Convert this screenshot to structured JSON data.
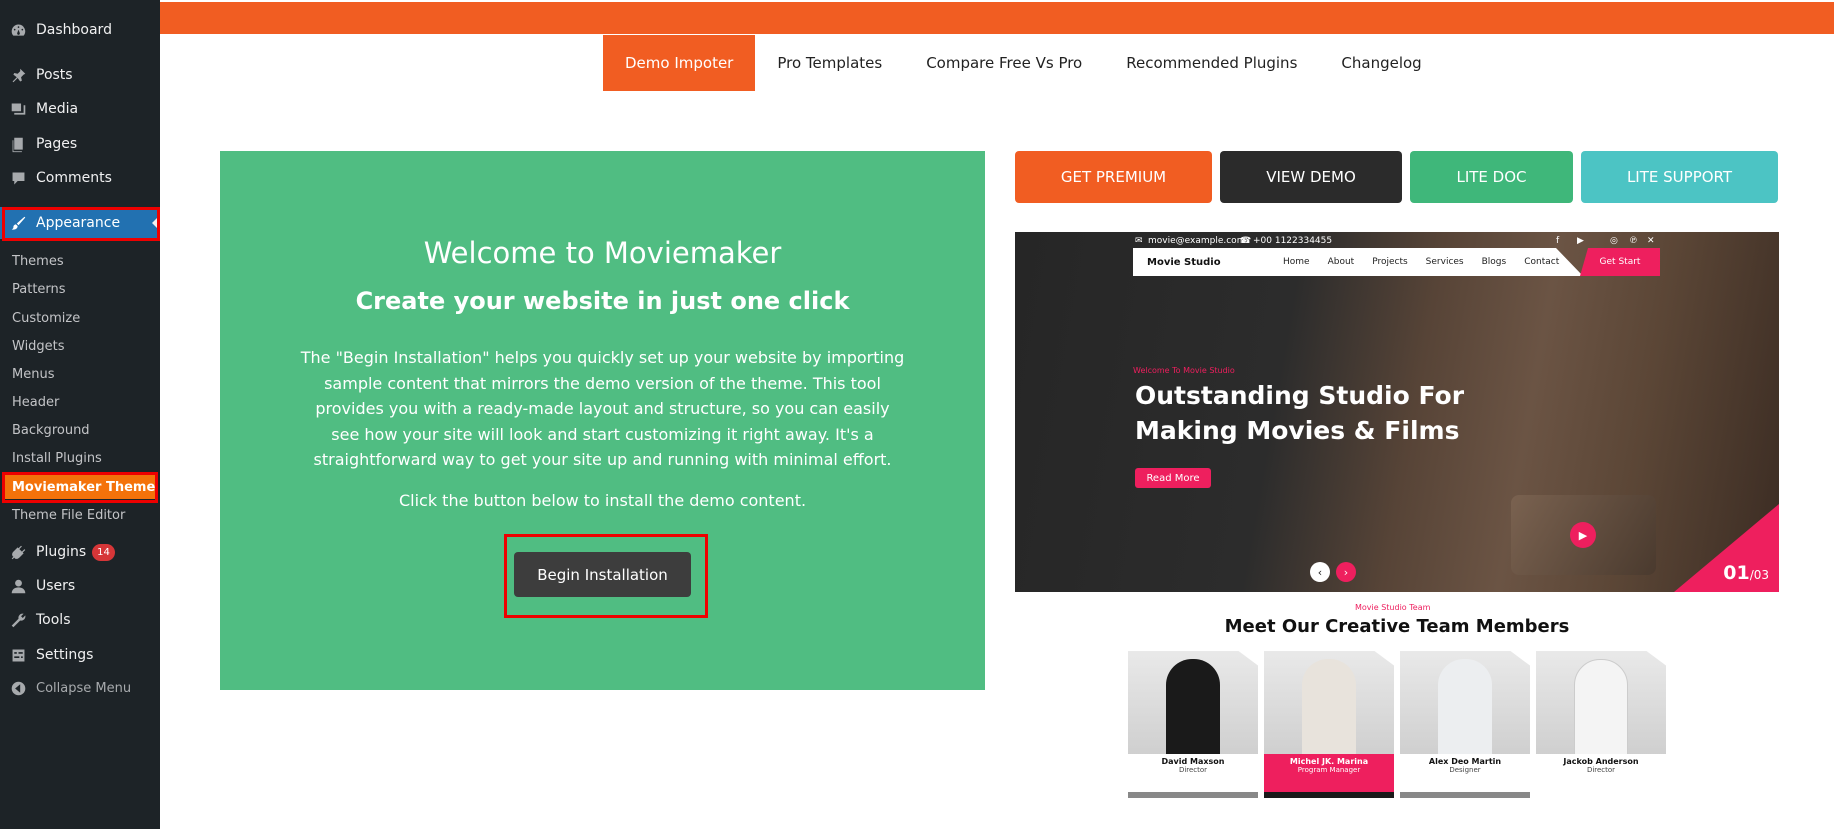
{
  "sidebar": {
    "items": [
      {
        "label": "Dashboard",
        "icon": "dashboard-icon"
      },
      {
        "label": "Posts",
        "icon": "pin-icon"
      },
      {
        "label": "Media",
        "icon": "media-icon"
      },
      {
        "label": "Pages",
        "icon": "pages-icon"
      },
      {
        "label": "Comments",
        "icon": "comment-icon"
      },
      {
        "label": "Appearance",
        "icon": "brush-icon"
      }
    ],
    "submenu": [
      "Themes",
      "Patterns",
      "Customize",
      "Widgets",
      "Menus",
      "Header",
      "Background",
      "Install Plugins"
    ],
    "current_sub": "Moviemaker Theme",
    "after_sub": "Theme File Editor",
    "lower": [
      {
        "label": "Plugins",
        "icon": "plugin-icon",
        "badge": "14"
      },
      {
        "label": "Users",
        "icon": "user-icon"
      },
      {
        "label": "Tools",
        "icon": "wrench-icon"
      },
      {
        "label": "Settings",
        "icon": "settings-icon"
      }
    ],
    "collapse": "Collapse Menu"
  },
  "tabs": [
    "Demo Impoter",
    "Pro Templates",
    "Compare Free Vs Pro",
    "Recommended Plugins",
    "Changelog"
  ],
  "welcome": {
    "title": "Welcome to Moviemaker",
    "subtitle": "Create your website in just one click",
    "paragraph": "The \"Begin Installation\" helps you quickly set up your website by importing sample content that mirrors the demo version of the theme. This tool provides you with a ready-made layout and structure, so you can easily see how your site will look and start customizing it right away. It's a straightforward way to get your site up and running with minimal effort.",
    "instruction": "Click the button below to install the demo content.",
    "button": "Begin Installation"
  },
  "action_buttons": [
    {
      "label": "GET PREMIUM",
      "color": "#f15d22"
    },
    {
      "label": "VIEW DEMO",
      "color": "#2b2b2b"
    },
    {
      "label": "LITE DOC",
      "color": "#3fb77a"
    },
    {
      "label": "LITE SUPPORT",
      "color": "#4cc4c4"
    }
  ],
  "preview": {
    "email": "movie@example.com",
    "phone": "+00 1122334455",
    "logo": "Movie Studio",
    "menu": [
      "Home",
      "About",
      "Projects",
      "Services",
      "Blogs",
      "Contact"
    ],
    "cta": "Get Start",
    "tagline": "Welcome To Movie Studio",
    "headline": "Outstanding Studio For Making Movies & Films",
    "read_more": "Read More",
    "slide_current": "01",
    "slide_total": "/03",
    "team_tag": "Movie Studio Team",
    "team_title": "Meet Our Creative Team Members",
    "members": [
      {
        "name": "David Maxson",
        "role": "Director"
      },
      {
        "name": "Michel JK. Marina",
        "role": "Program Manager"
      },
      {
        "name": "Alex Deo Martin",
        "role": "Designer"
      },
      {
        "name": "Jackob Anderson",
        "role": "Director"
      }
    ]
  },
  "colors": {
    "accent": "#f15d22",
    "welcome_bg": "#50bd82",
    "wp_blue": "#2271b1",
    "preview_pink": "#ee1f5e"
  }
}
